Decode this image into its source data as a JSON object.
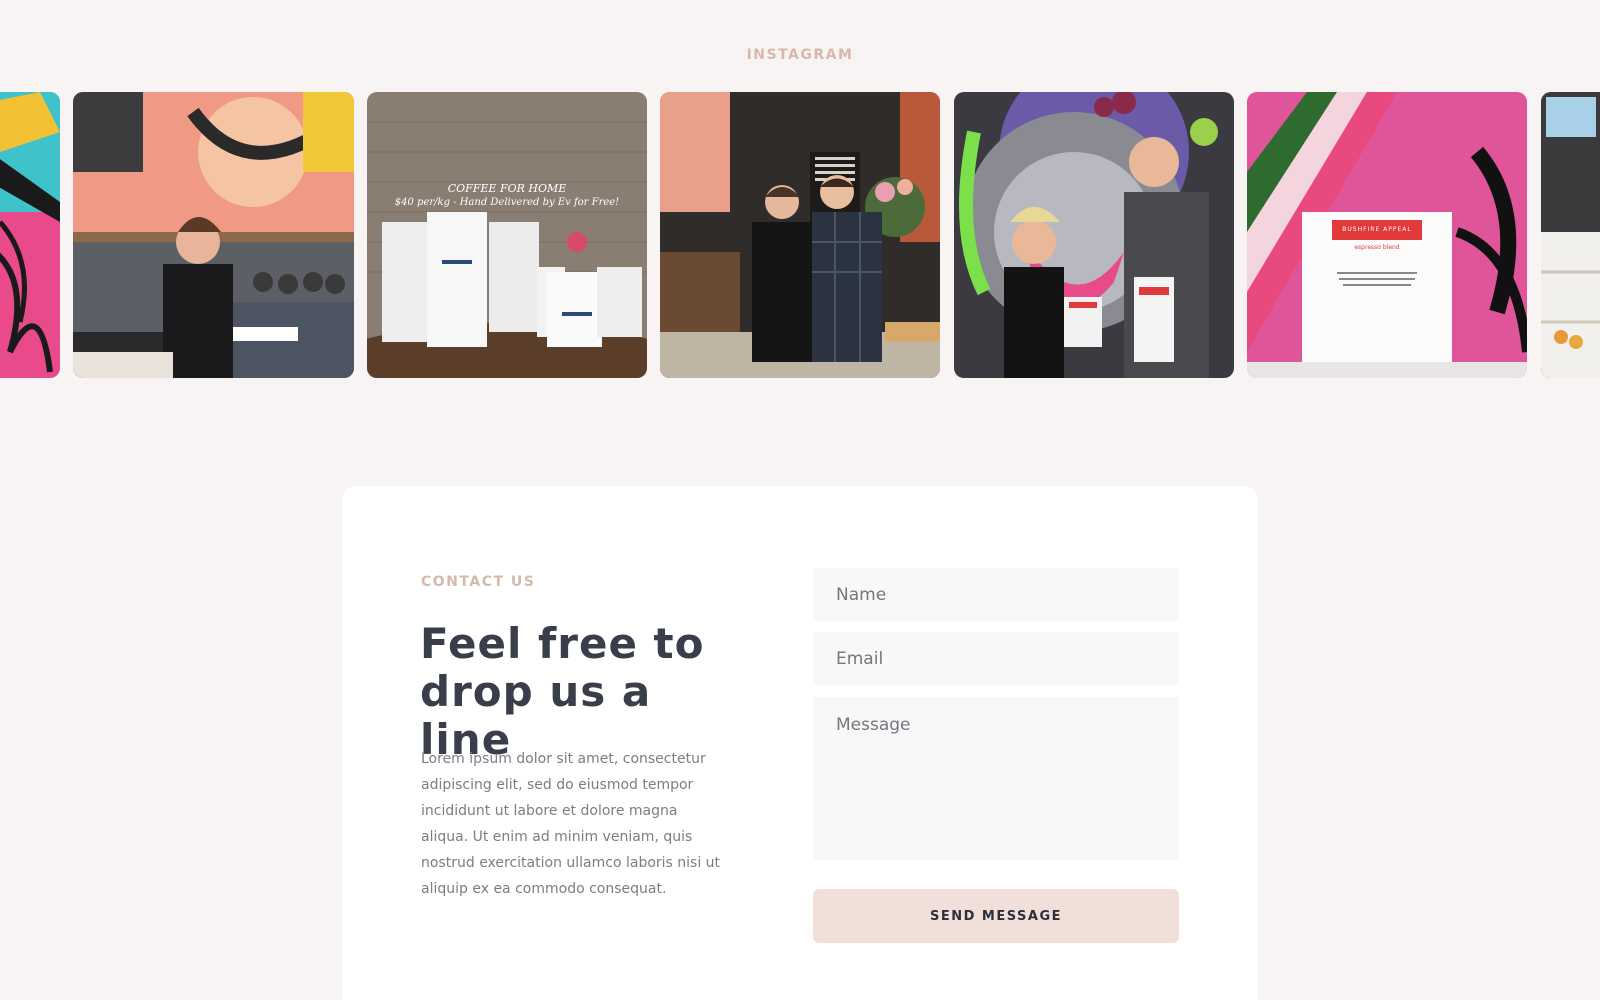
{
  "instagram": {
    "heading": "INSTAGRAM",
    "tiles": [
      {
        "name": "mural-partial-left",
        "caption": null
      },
      {
        "name": "barista-espresso-machine",
        "caption": null
      },
      {
        "name": "coffee-bags-promo",
        "caption_line1": "COFFEE FOR HOME",
        "caption_line2": "$40 per/kg - Hand Delivered by Ev for Free!"
      },
      {
        "name": "two-owners-cafe",
        "caption": null
      },
      {
        "name": "gorilla-mural-coffee",
        "caption": null
      },
      {
        "name": "bushfire-appeal-bag",
        "bag_label": "BUSHFIRE APPEAL",
        "bag_sub": "espresso blend"
      },
      {
        "name": "cafe-partial-right",
        "caption": null
      }
    ]
  },
  "contact": {
    "eyebrow": "CONTACT US",
    "headline": "Feel free to drop us a line",
    "body": "Lorem ipsum dolor sit amet, consectetur adipiscing elit, sed do eiusmod tempor incididunt ut labore et dolore magna aliqua. Ut enim ad minim veniam, quis nostrud exercitation ullamco laboris nisi ut aliquip ex ea commodo consequat.",
    "form": {
      "name_placeholder": "Name",
      "email_placeholder": "Email",
      "message_placeholder": "Message",
      "submit_label": "SEND MESSAGE"
    }
  },
  "colors": {
    "page_bg": "#f8f4f3",
    "accent": "#d7b8ad",
    "button_bg": "#f1dfd9",
    "heading_text": "#3a3e4b"
  }
}
